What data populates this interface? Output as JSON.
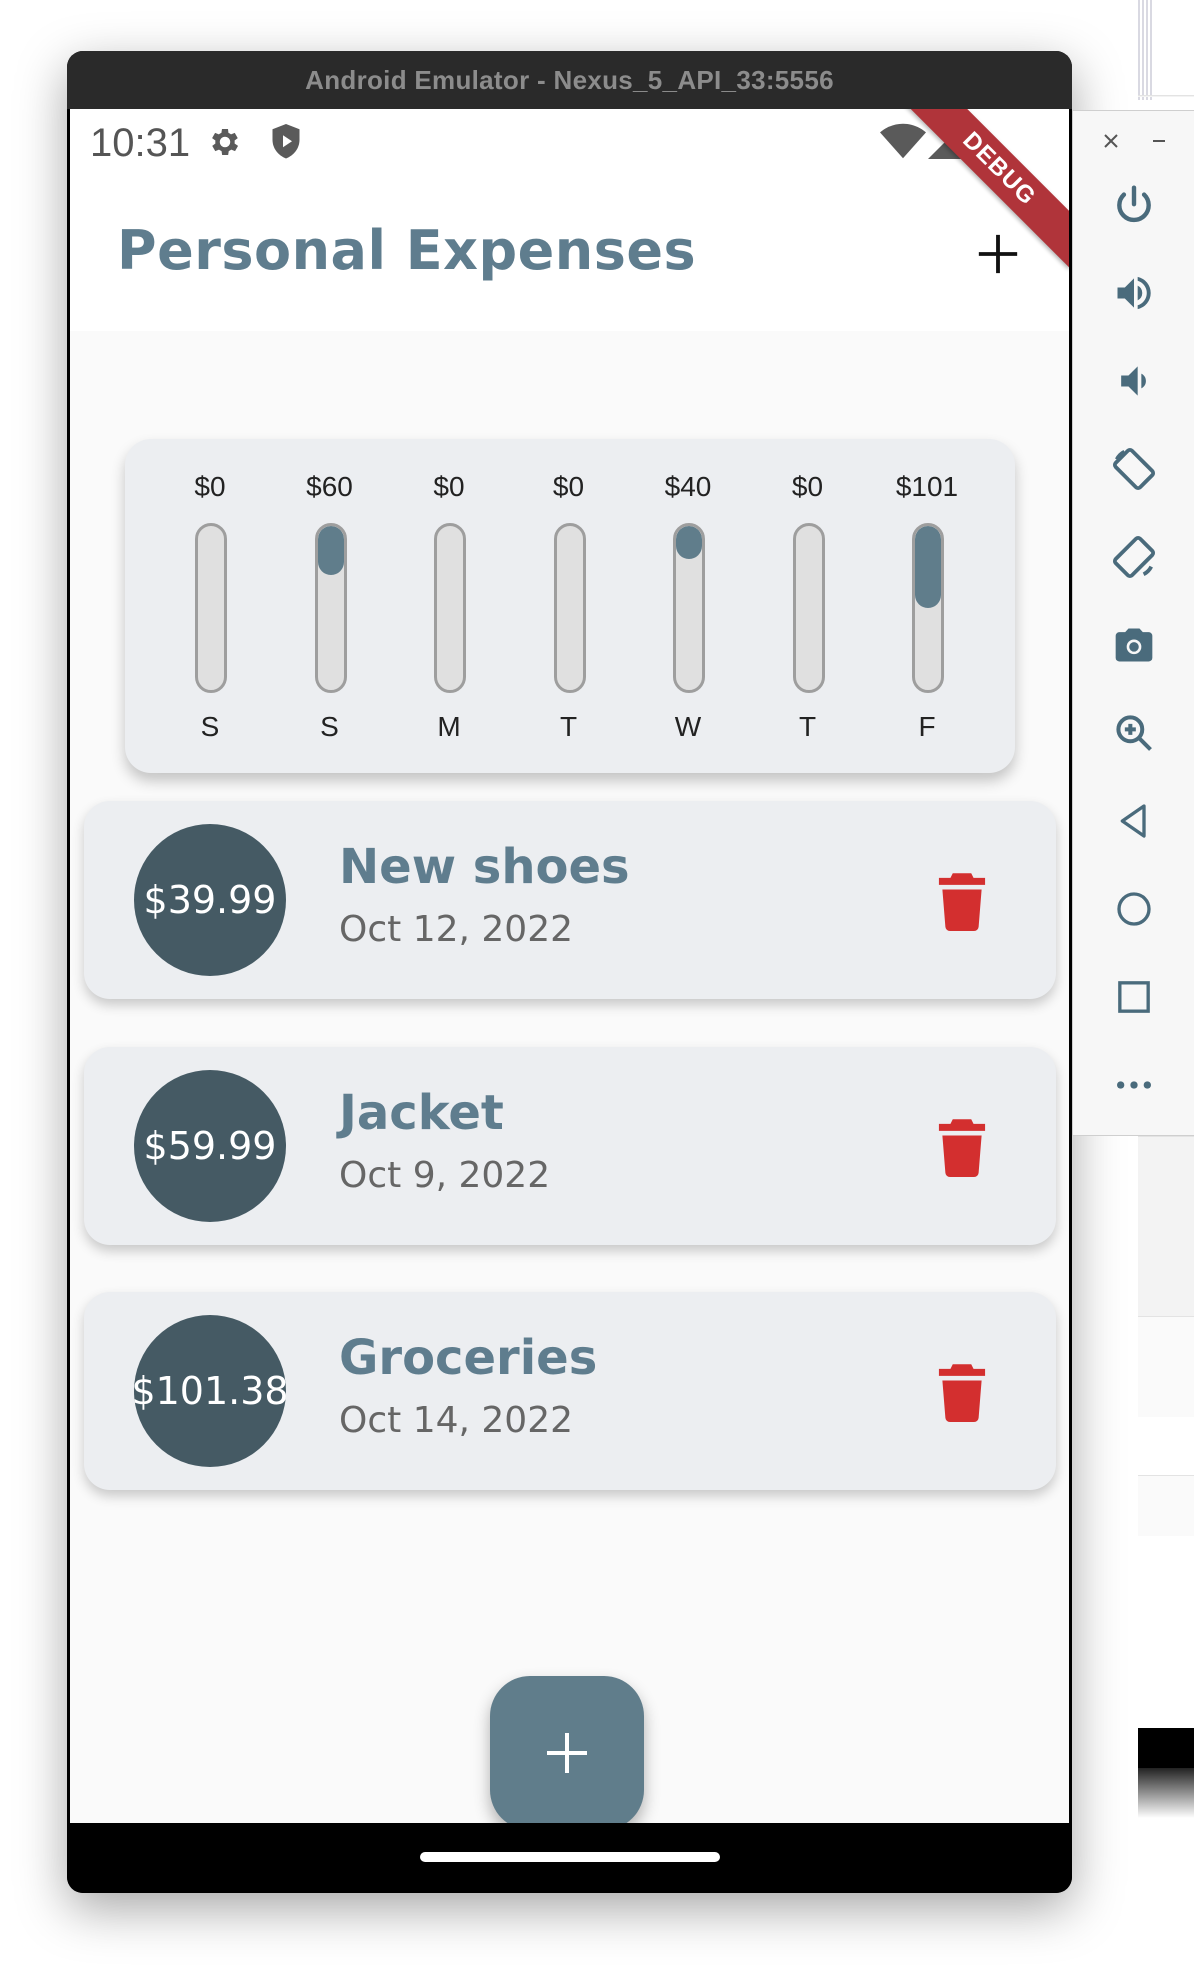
{
  "window": {
    "title": "Android Emulator - Nexus_5_API_33:5556"
  },
  "status_bar": {
    "time": "10:31",
    "icons": [
      "gear-icon",
      "shield-play-icon",
      "wifi-icon",
      "cell-signal-icon"
    ]
  },
  "debug_banner": "DEBUG",
  "app_bar": {
    "title": "Personal Expenses",
    "add_icon": "plus-icon"
  },
  "chart_data": {
    "type": "bar",
    "categories": [
      "S",
      "S",
      "M",
      "T",
      "W",
      "T",
      "F"
    ],
    "labels": [
      "$0",
      "$60",
      "$0",
      "$0",
      "$40",
      "$0",
      "$101"
    ],
    "values": [
      0,
      60,
      0,
      0,
      40,
      0,
      101
    ],
    "max_total": 201.37,
    "bar_color": "#607d8b",
    "track_color": "#e0e0e0"
  },
  "transactions": [
    {
      "amount": "$39.99",
      "title": "New shoes",
      "date": "Oct 12, 2022"
    },
    {
      "amount": "$59.99",
      "title": "Jacket",
      "date": "Oct 9, 2022"
    },
    {
      "amount": "$101.38",
      "title": "Groceries",
      "date": "Oct 14, 2022"
    }
  ],
  "colors": {
    "primary": "#607d8b",
    "avatar": "#455a64",
    "delete": "#d32f2f",
    "title": "#5f7d8e"
  },
  "fab": {
    "icon": "plus-icon"
  },
  "toolbar": {
    "window_controls": [
      "close-icon",
      "minimize-icon"
    ],
    "buttons": [
      "power-icon",
      "volume-up-icon",
      "volume-down-icon",
      "rotate-left-icon",
      "rotate-right-icon",
      "camera-icon",
      "zoom-icon",
      "back-icon",
      "home-icon",
      "overview-icon",
      "more-icon"
    ]
  }
}
